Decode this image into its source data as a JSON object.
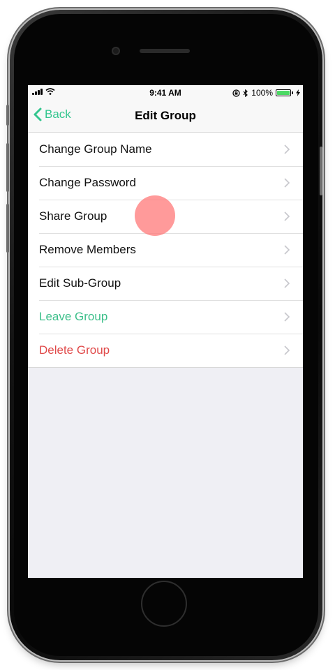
{
  "status_bar": {
    "time": "9:41 AM",
    "battery_percent_label": "100%",
    "battery_level": 1.0,
    "battery_color": "#4cd964"
  },
  "nav": {
    "back_label": "Back",
    "title": "Edit Group",
    "accent_color": "#34c68f"
  },
  "menu": {
    "items": [
      {
        "label": "Change Group Name",
        "color": "#111111"
      },
      {
        "label": "Change Password",
        "color": "#111111"
      },
      {
        "label": "Share Group",
        "color": "#111111"
      },
      {
        "label": "Remove Members",
        "color": "#111111"
      },
      {
        "label": "Edit Sub-Group",
        "color": "#111111"
      },
      {
        "label": "Leave Group",
        "color": "#3cbf8a"
      },
      {
        "label": "Delete Group",
        "color": "#e04848"
      }
    ]
  },
  "icons": {
    "back": "chevron-left-icon",
    "disclosure": "chevron-right-icon",
    "signal": "cellular-signal-icon",
    "wifi": "wifi-icon",
    "orientation_lock": "orientation-lock-icon",
    "bluetooth": "bluetooth-icon",
    "battery": "battery-icon",
    "charging": "charging-bolt-icon"
  }
}
